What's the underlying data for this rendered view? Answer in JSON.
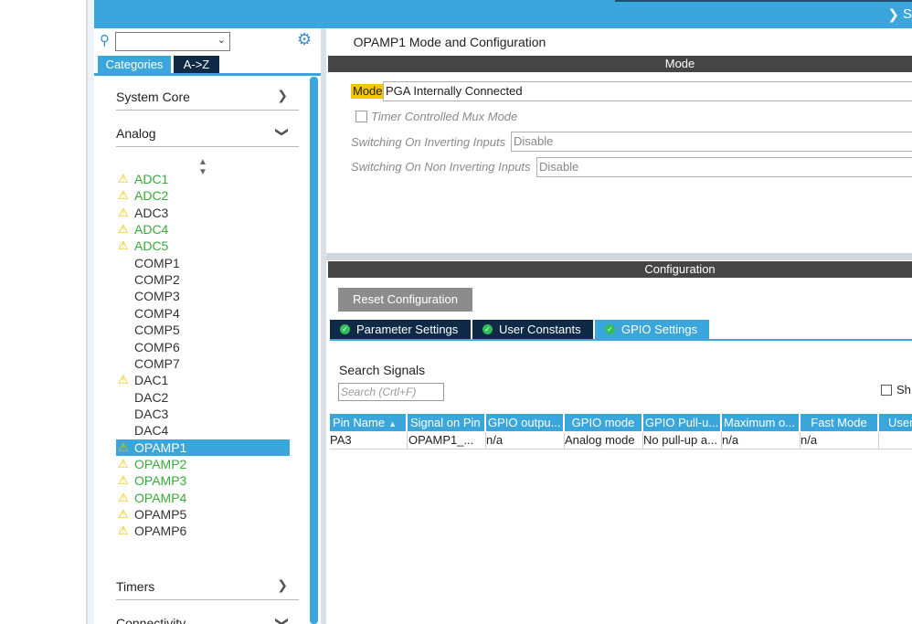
{
  "header": {
    "collapse_icon": "chevron-down-icon",
    "title_fragment": "S"
  },
  "sidebar": {
    "search": {
      "value": ""
    },
    "tabs": [
      {
        "label": "Categories",
        "active": true
      },
      {
        "label": "A->Z",
        "active": false
      }
    ],
    "categories": {
      "system_core": "System Core",
      "analog": "Analog",
      "timers": "Timers",
      "connectivity": "Connectivity"
    },
    "analog_items": [
      {
        "name": "ADC1",
        "status": "warning-ok"
      },
      {
        "name": "ADC2",
        "status": "warning-ok"
      },
      {
        "name": "ADC3",
        "status": "warning"
      },
      {
        "name": "ADC4",
        "status": "warning-ok"
      },
      {
        "name": "ADC5",
        "status": "warning-ok"
      },
      {
        "name": "COMP1",
        "status": "none"
      },
      {
        "name": "COMP2",
        "status": "none"
      },
      {
        "name": "COMP3",
        "status": "none"
      },
      {
        "name": "COMP4",
        "status": "none"
      },
      {
        "name": "COMP5",
        "status": "none"
      },
      {
        "name": "COMP6",
        "status": "none"
      },
      {
        "name": "COMP7",
        "status": "none"
      },
      {
        "name": "DAC1",
        "status": "warning"
      },
      {
        "name": "DAC2",
        "status": "none"
      },
      {
        "name": "DAC3",
        "status": "none"
      },
      {
        "name": "DAC4",
        "status": "none"
      },
      {
        "name": "OPAMP1",
        "status": "selected"
      },
      {
        "name": "OPAMP2",
        "status": "warning-ok"
      },
      {
        "name": "OPAMP3",
        "status": "warning-ok"
      },
      {
        "name": "OPAMP4",
        "status": "warning-ok"
      },
      {
        "name": "OPAMP5",
        "status": "warning"
      },
      {
        "name": "OPAMP6",
        "status": "warning"
      }
    ]
  },
  "main": {
    "title": "OPAMP1 Mode and Configuration",
    "mode_section": "Mode",
    "mode": {
      "label": "Mode",
      "value": "PGA Internally Connected"
    },
    "timer_mux": {
      "label": "Timer Controlled Mux Mode",
      "checked": false
    },
    "inverting": {
      "label": "Switching On Inverting Inputs",
      "value": "Disable"
    },
    "non_inverting": {
      "label": "Switching On Non Inverting Inputs",
      "value": "Disable"
    },
    "config_section": "Configuration",
    "reset_button": "Reset Configuration",
    "config_tabs": [
      {
        "label": "Parameter Settings",
        "active": false
      },
      {
        "label": "User Constants",
        "active": false
      },
      {
        "label": "GPIO Settings",
        "active": true
      }
    ],
    "search_signals": {
      "label": "Search Signals",
      "placeholder": "Search (Crtl+F)"
    },
    "show_label": "Sh",
    "table": {
      "headers": [
        "Pin Name",
        "Signal on Pin",
        "GPIO outpu...",
        "GPIO mode",
        "GPIO Pull-u...",
        "Maximum o...",
        "Fast Mode",
        "User"
      ],
      "rows": [
        [
          "PA3",
          "OPAMP1_...",
          "n/a",
          "Analog mode",
          "No pull-up a...",
          "n/a",
          "n/a",
          ""
        ]
      ]
    }
  },
  "colors": {
    "accent": "#3aa6db",
    "dark_tab": "#0e2a47",
    "warning": "#f0c000",
    "ok_green": "#3aaa3a",
    "section_bar": "#454545"
  }
}
